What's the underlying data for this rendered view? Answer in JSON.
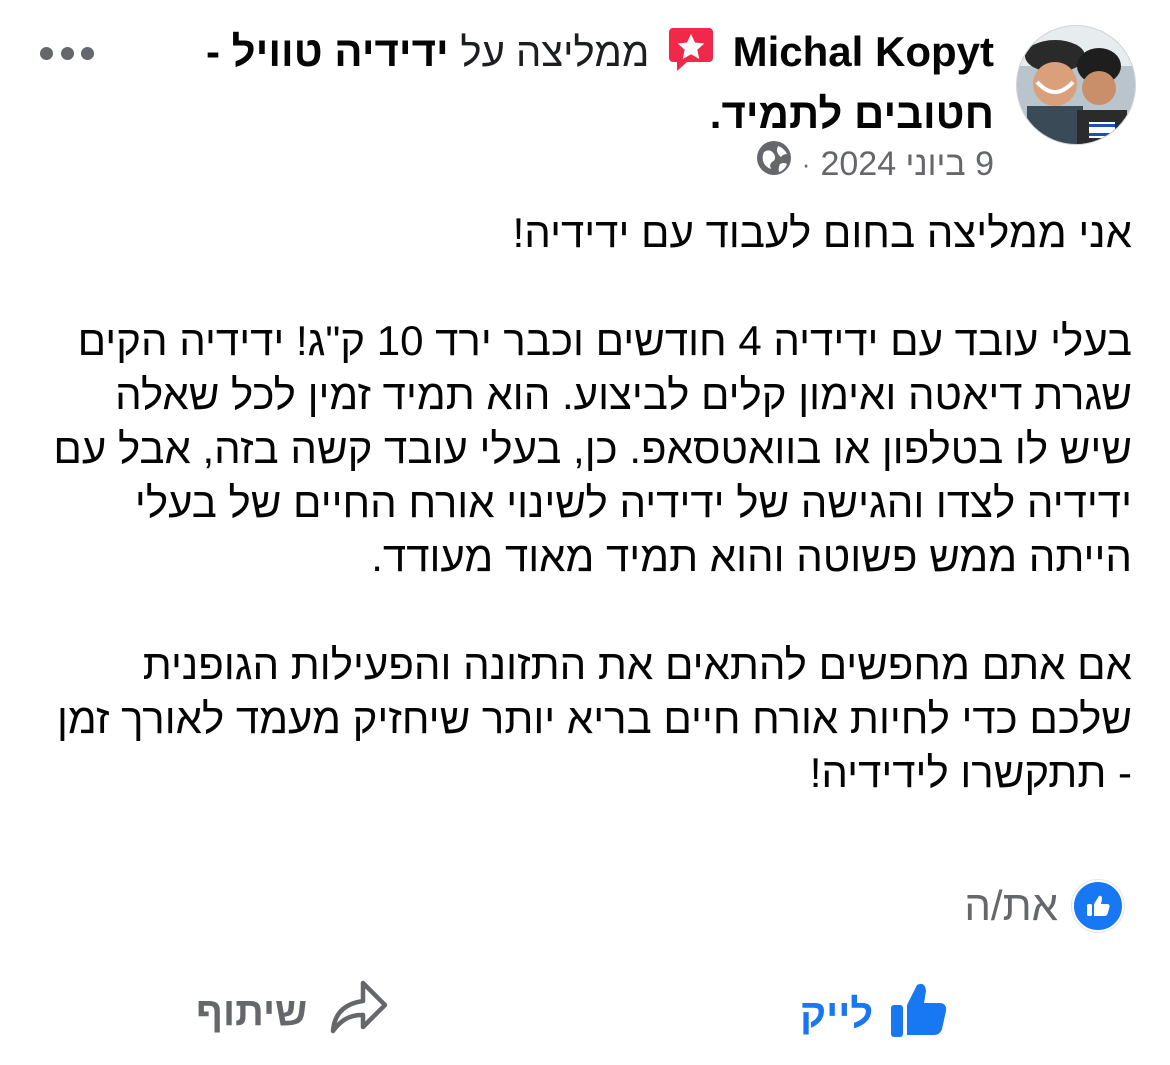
{
  "post": {
    "author": "Michal Kopyt",
    "recommends_text": "ממליצה על",
    "page_name": "ידידיה טוויל - חטובים לתמיד",
    "page_name_suffix": ".",
    "date": "9 ביוני 2024",
    "separator": "·",
    "audience_icon": "globe-icon",
    "author_icon": "recommendation-star-icon",
    "paragraphs": [
      "אני ממליצה בחום לעבוד עם ידידיה!",
      "בעלי עובד עם ידידיה 4 חודשים וכבר ירד 10 ק\"ג! ידידיה הקים שגרת דיאטה ואימון קלים לביצוע. הוא תמיד זמין לכל שאלה שיש לו בטלפון או בוואטסאפ. כן, בעלי עובד קשה בזה, אבל עם ידידיה לצדו והגישה של ידידיה לשינוי אורח החיים של בעלי הייתה ממש פשוטה והוא תמיד מאוד מעודד.",
      "אם אתם מחפשים להתאים את התזונה והפעילות הגופנית שלכם כדי לחיות אורח חיים בריא יותר שיחזיק מעמד לאורך זמן - תתקשרו לידידיה!"
    ]
  },
  "reactions": {
    "icon": "like-icon",
    "label": "את/ה"
  },
  "actions": {
    "like_label": "לייק",
    "share_label": "שיתוף"
  },
  "colors": {
    "accent": "#1877f2",
    "secondary_text": "#65676b",
    "badge": "#f02849"
  }
}
